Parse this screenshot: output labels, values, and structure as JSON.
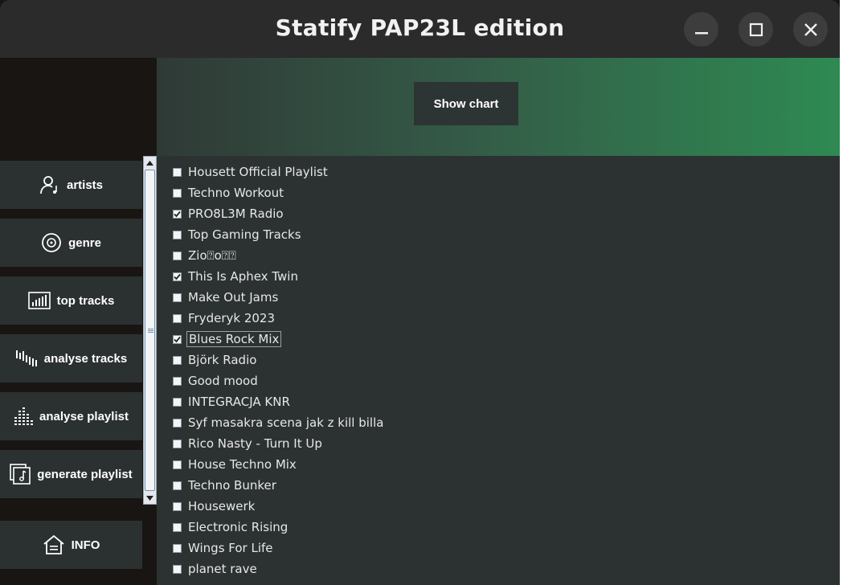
{
  "window": {
    "title": "Statify PAP23L edition",
    "controls": [
      "minimize",
      "maximize",
      "close"
    ]
  },
  "sidebar": {
    "items": [
      {
        "label": "artists",
        "icon": "user-music-icon"
      },
      {
        "label": "genre",
        "icon": "vinyl-disc-icon"
      },
      {
        "label": "top tracks",
        "icon": "bar-chart-icon"
      },
      {
        "label": "analyse tracks",
        "icon": "waveform-icon"
      },
      {
        "label": "analyse playlist",
        "icon": "equalizer-icon"
      },
      {
        "label": "generate playlist",
        "icon": "music-library-icon"
      }
    ],
    "info_label": "INFO"
  },
  "header": {
    "show_chart_label": "Show chart"
  },
  "playlists": [
    {
      "name": "Housett Official Playlist",
      "checked": false
    },
    {
      "name": "Techno Workout",
      "checked": false
    },
    {
      "name": "PRO8L3M Radio",
      "checked": true
    },
    {
      "name": "Top Gaming Tracks",
      "checked": false
    },
    {
      "name": "Zio⍰o⍰⍰",
      "checked": false
    },
    {
      "name": "This Is Aphex Twin",
      "checked": true
    },
    {
      "name": "Make Out Jams",
      "checked": false
    },
    {
      "name": "Fryderyk 2023",
      "checked": false
    },
    {
      "name": "Blues Rock Mix",
      "checked": true,
      "focused": true
    },
    {
      "name": "Björk Radio",
      "checked": false
    },
    {
      "name": "Good mood",
      "checked": false
    },
    {
      "name": "INTEGRACJA KNR",
      "checked": false
    },
    {
      "name": "Syf masakra scena jak z kill billa",
      "checked": false
    },
    {
      "name": "Rico Nasty - Turn It Up",
      "checked": false
    },
    {
      "name": "House Techno Mix",
      "checked": false
    },
    {
      "name": "Techno Bunker",
      "checked": false
    },
    {
      "name": "Housewerk",
      "checked": false
    },
    {
      "name": "Electronic Rising",
      "checked": false
    },
    {
      "name": "Wings For Life",
      "checked": false
    },
    {
      "name": "planet rave",
      "checked": false
    }
  ],
  "colors": {
    "titlebar": "#2b2b2b",
    "sidebar_button": "#2b3130",
    "list_background": "#2c3231",
    "banner_accent": "#2e8a52"
  }
}
